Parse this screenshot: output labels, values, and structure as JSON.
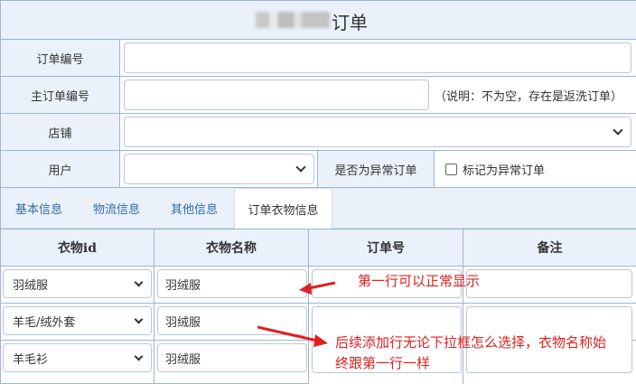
{
  "title": "订单",
  "form": {
    "order_no_label": "订单编号",
    "order_no_value": "",
    "main_order_no_label": "主订单编号",
    "main_order_no_value": "",
    "main_order_no_note": "（说明：不为空，存在是返洗订单）",
    "store_label": "店铺",
    "store_value": "",
    "user_label": "用户",
    "user_value": "",
    "abnormal_label": "是否为异常订单",
    "abnormal_checkbox_label": "标记为异常订单"
  },
  "tabs": [
    {
      "label": "基本信息"
    },
    {
      "label": "物流信息"
    },
    {
      "label": "其他信息"
    },
    {
      "label": "订单衣物信息"
    }
  ],
  "active_tab": "订单衣物信息",
  "table": {
    "headers": [
      "衣物id",
      "衣物名称",
      "订单号",
      "备注"
    ],
    "rows": [
      {
        "clothing_id": "羽绒服",
        "clothing_name": "羽绒服",
        "order_no": "",
        "remark": ""
      },
      {
        "clothing_id": "羊毛/绒外套",
        "clothing_name": "羽绒服",
        "order_no": "",
        "remark": ""
      },
      {
        "clothing_id": "羊毛衫",
        "clothing_name": "羽绒服",
        "order_no": "",
        "remark": ""
      }
    ]
  },
  "annotations": {
    "first": "第一行可以正常显示",
    "second_line1": "后续添加行无论下拉框怎么选择，衣物名称始",
    "second_line2": "终跟第一行一样",
    "color": "#e02020"
  }
}
